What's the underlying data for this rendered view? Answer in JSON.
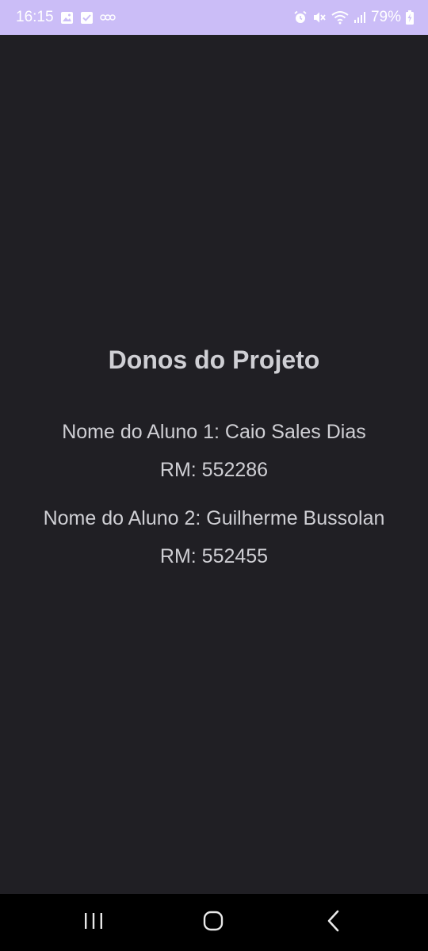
{
  "status_bar": {
    "time": "16:15",
    "battery": "79%",
    "background": "#cbbdf7",
    "left_icons": [
      "gallery-icon",
      "check-icon",
      "voicemail-icon"
    ],
    "right_icons": [
      "alarm-icon",
      "mute-icon",
      "wifi-icon",
      "signal-icon",
      "battery-charging-icon"
    ]
  },
  "main": {
    "title": "Donos do Projeto",
    "students": [
      {
        "name_line": "Nome do Aluno 1: Caio Sales Dias",
        "rm_line": "RM: 552286"
      },
      {
        "name_line": "Nome do Aluno 2: Guilherme Bussolan",
        "rm_line": "RM: 552455"
      }
    ],
    "background": "#201f24",
    "text_color": "#cfcfd4"
  },
  "nav_bar": {
    "buttons": [
      "recents-icon",
      "home-icon",
      "back-icon"
    ]
  }
}
